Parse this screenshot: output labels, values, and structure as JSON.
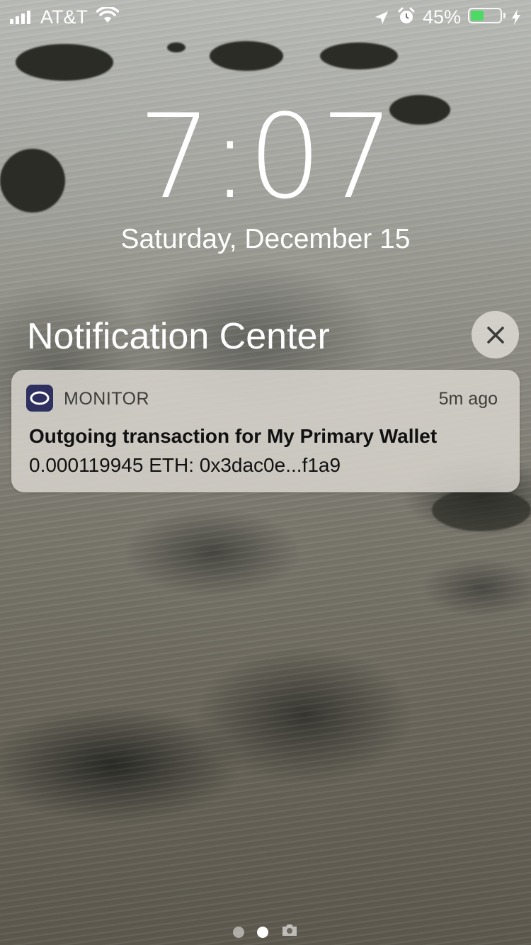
{
  "status_bar": {
    "carrier": "AT&T",
    "battery_percent": "45%",
    "battery_level": 0.45,
    "battery_color": "#4cd964",
    "icons": [
      "signal-icon",
      "wifi-icon",
      "location-arrow-icon",
      "alarm-icon",
      "charging-bolt-icon"
    ]
  },
  "lock_screen": {
    "time": "7:07",
    "date": "Saturday, December 15"
  },
  "notification_center": {
    "title": "Notification Center",
    "close_icon": "close-icon"
  },
  "notification": {
    "app_name": "MONITOR",
    "app_icon_color": "#2e3060",
    "time_ago": "5m ago",
    "title": "Outgoing transaction for My Primary Wallet",
    "body": "0.000119945 ETH: 0x3dac0e...f1a9"
  },
  "page_indicator": {
    "pages": 3,
    "current": 2,
    "last_icon": "camera-icon"
  }
}
